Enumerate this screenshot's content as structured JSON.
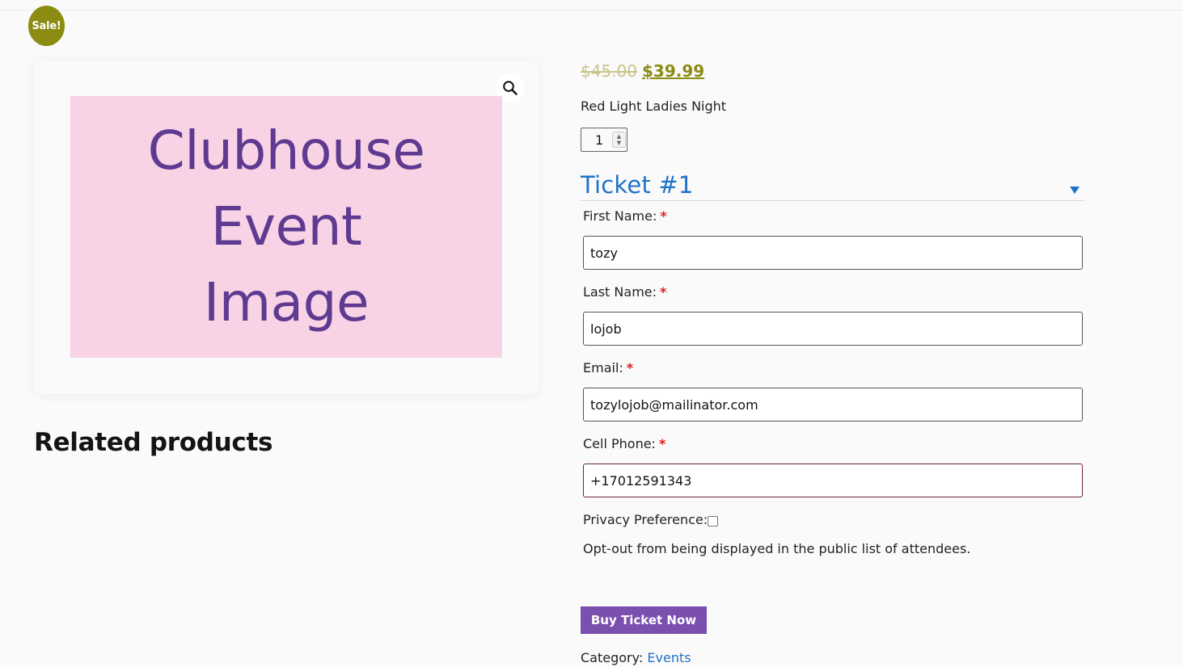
{
  "badge": {
    "label": "Sale!"
  },
  "gallery": {
    "image_lines": [
      "Clubhouse",
      "Event",
      "Image"
    ],
    "zoom_icon": "magnifier-icon"
  },
  "related": {
    "title": "Related products"
  },
  "product": {
    "price_old": "$45.00",
    "price_new": "$39.99",
    "event_name": "Red Light Ladies Night",
    "quantity": "1"
  },
  "ticket": {
    "title": "Ticket #1",
    "fields": {
      "first_name": {
        "label": "First Name:",
        "value": "tozy"
      },
      "last_name": {
        "label": "Last Name:",
        "value": "lojob"
      },
      "email": {
        "label": "Email:",
        "value": "tozylojob@mailinator.com"
      },
      "cell_phone": {
        "label": "Cell Phone:",
        "value": "+17012591343"
      }
    },
    "required_mark": "*",
    "privacy_label": "Privacy Preference:",
    "optout_text": "Opt-out from being displayed in the public list of attendees."
  },
  "actions": {
    "buy_label": "Buy Ticket Now"
  },
  "category": {
    "label": "Category:",
    "link": "Events"
  },
  "colors": {
    "sale": "#8c8b12",
    "ticket_blue": "#1e72c9",
    "buy_purple": "#7b4fae",
    "image_bg": "#f8d3e5",
    "image_text": "#5e3a91",
    "required": "#e01b1b"
  }
}
